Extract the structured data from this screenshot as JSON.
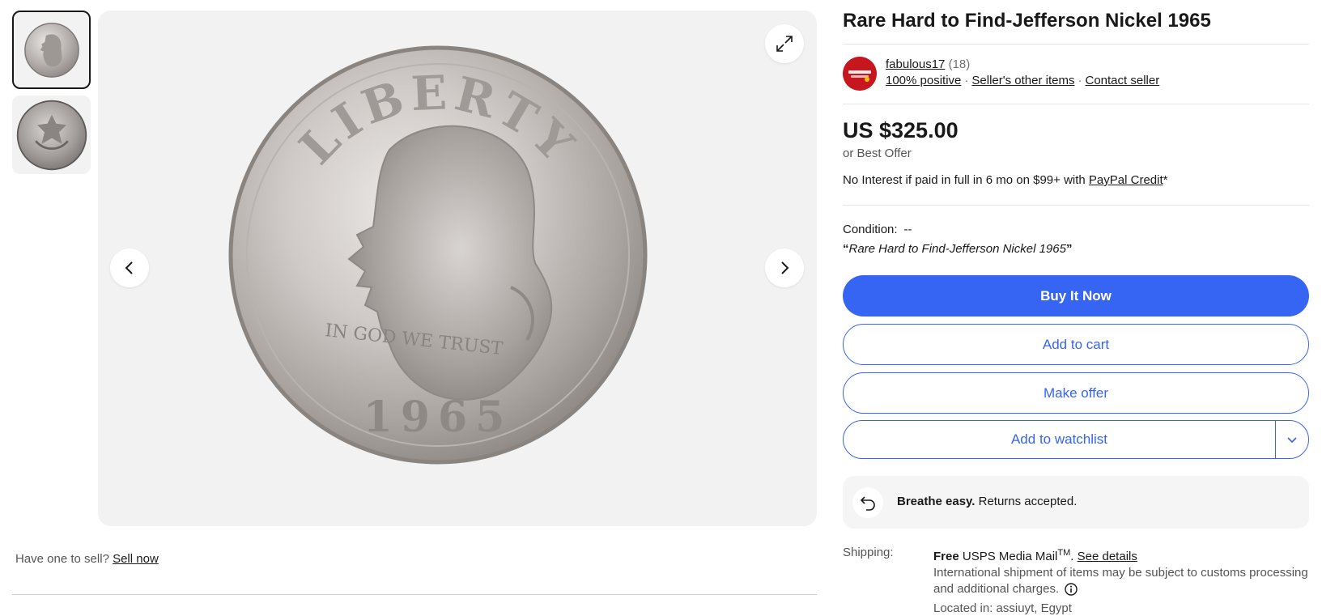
{
  "listing": {
    "title": "Rare Hard to Find-Jefferson Nickel 1965"
  },
  "gallery": {
    "coin_top_text": "LIBERTY",
    "coin_motto": "IN GOD WE TRUST",
    "coin_year": "1965",
    "thumbnails": [
      {
        "name": "coin-obverse"
      },
      {
        "name": "coin-reverse"
      }
    ],
    "icons": {
      "prev": "chevron-left-icon",
      "next": "chevron-right-icon",
      "expand": "expand-icon"
    }
  },
  "sell": {
    "prompt": "Have one to sell?",
    "link": "Sell now"
  },
  "seller": {
    "name": "fabulous17",
    "feedback_count": "(18)",
    "positive": "100% positive",
    "other_items": "Seller's other items",
    "contact": "Contact seller"
  },
  "pricing": {
    "price": "US $325.00",
    "best_offer": "or Best Offer",
    "paypal_prefix": "No Interest if paid in full in 6 mo on $99+ with ",
    "paypal_link": "PayPal Credit",
    "paypal_suffix": "*"
  },
  "condition": {
    "label": "Condition:",
    "value": "--",
    "quote": "Rare Hard to Find-Jefferson Nickel 1965"
  },
  "actions": {
    "buy_now": "Buy It Now",
    "add_to_cart": "Add to cart",
    "make_offer": "Make offer",
    "add_to_watchlist": "Add to watchlist"
  },
  "returns": {
    "bold": "Breathe easy.",
    "text": " Returns accepted."
  },
  "shipping": {
    "label": "Shipping:",
    "free": "Free",
    "service": " USPS Media Mail",
    "tm": "TM",
    "period": ".",
    "see_details": "See details",
    "note": "International shipment of items may be subject to customs processing and additional charges.",
    "located": "Located in: assiuyt, Egypt"
  },
  "colors": {
    "accent": "#3665f3",
    "text": "#191919",
    "muted": "#555555",
    "avatar": "#c8161e",
    "panel": "#f2f2f2"
  }
}
